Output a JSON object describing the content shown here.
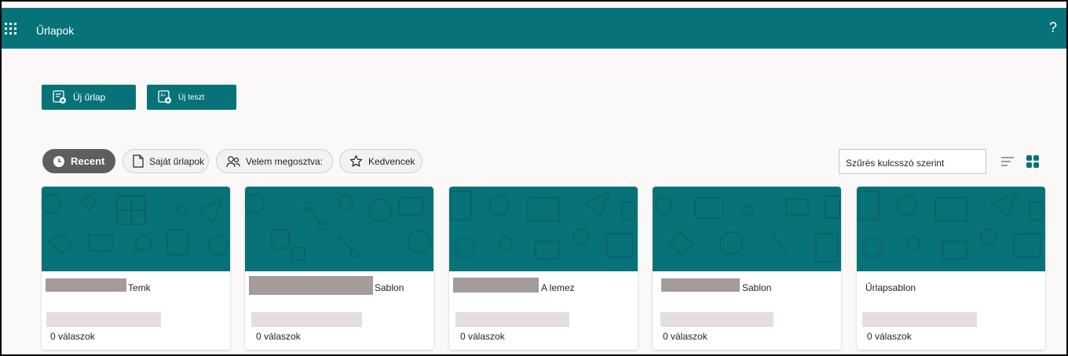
{
  "header": {
    "app_title": "Űrlapok",
    "help_label": "?"
  },
  "actions": {
    "new_form": "Új űrlap",
    "new_quiz": "Új teszt"
  },
  "filters": {
    "recent": "Recent",
    "my_forms": "Saját űrlapok",
    "shared": "Velem megosztva:",
    "favorites": "Kedvencek"
  },
  "search": {
    "placeholder": "Szűrés kulcsszó szerint"
  },
  "cards": [
    {
      "title": "Temk",
      "responses": "0 válaszok"
    },
    {
      "title": "Sablon",
      "responses": "0 válaszok"
    },
    {
      "title": "A lemez",
      "responses": "0 válaszok"
    },
    {
      "title": "Sablon",
      "responses": "0 válaszok"
    },
    {
      "title": "Űrlapsablon",
      "responses": "0 válaszok"
    }
  ],
  "colors": {
    "brand": "#077378",
    "active_pill": "#605e5c",
    "view_active": "#077378"
  },
  "icons": [
    "waffle-icon",
    "help-icon",
    "new-form-icon",
    "new-quiz-icon",
    "clock-icon",
    "document-icon",
    "people-icon",
    "star-icon",
    "list-view-icon",
    "grid-view-icon"
  ]
}
